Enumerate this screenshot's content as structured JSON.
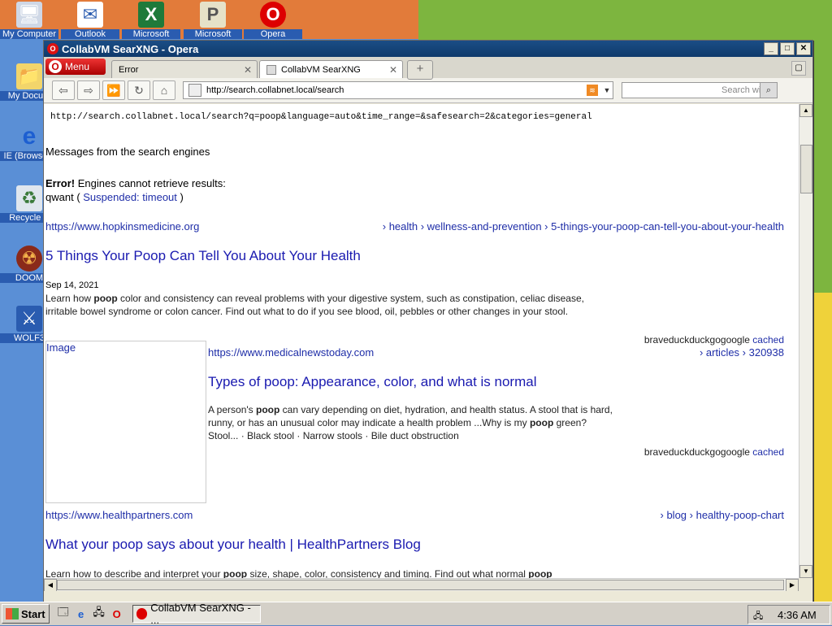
{
  "desktop": {
    "icons": [
      {
        "label": "My Computer",
        "icon": "computer-icon",
        "glyph": "🖥"
      },
      {
        "label": "Outlook",
        "icon": "outlook-icon",
        "glyph": "✉"
      },
      {
        "label": "Microsoft",
        "icon": "excel-icon",
        "glyph": "X"
      },
      {
        "label": "Microsoft",
        "icon": "project-icon",
        "glyph": "P"
      },
      {
        "label": "Opera",
        "icon": "opera-icon",
        "glyph": "O"
      },
      {
        "label": "My Docum",
        "icon": "folder-icon",
        "glyph": "📁"
      },
      {
        "label": "IE (Browserv",
        "icon": "ie-icon",
        "glyph": "e"
      },
      {
        "label": "Recycle B",
        "icon": "recycle-bin-icon",
        "glyph": "♻"
      },
      {
        "label": "DOOM",
        "icon": "doom-icon",
        "glyph": "☢"
      },
      {
        "label": "WOLF3",
        "icon": "wolf3d-icon",
        "glyph": "⚔"
      }
    ]
  },
  "window": {
    "title": "CollabVM SearXNG - Opera",
    "menu_label": "Menu",
    "tabs": [
      {
        "label": "Error"
      },
      {
        "label": "CollabVM SearXNG"
      }
    ],
    "address": "http://search.collabnet.local/search",
    "search_placeholder": "Search with Co"
  },
  "page": {
    "raw_url": "http://search.collabnet.local/search?q=poop&language=auto&time_range=&safesearch=2&categories=general",
    "messages_heading": "Messages from the search engines",
    "error_label": "Error!",
    "error_text": " Engines cannot retrieve results:",
    "engine_name": "qwant",
    "engine_status": "Suspended: timeout",
    "results": [
      {
        "url": "https://www.hopkinsmedicine.org",
        "crumbs": "› health › wellness-and-prevention › 5-things-your-poop-can-tell-you-about-your-health",
        "title": "5 Things Your Poop Can Tell You About Your Health",
        "date": "Sep 14, 2021",
        "snippet_parts": [
          "Learn how ",
          "poop",
          " color and consistency can reveal problems with your digestive system, such as constipation, celiac disease, irritable bowel syndrome or colon cancer. Find out what to do if you see blood, oil, pebbles or other changes in your stool."
        ],
        "engines": "braveduckduckgogoogle",
        "cached": "cached"
      },
      {
        "image_label": "Image",
        "url": "https://www.medicalnewstoday.com",
        "crumbs": "› articles › 320938",
        "title": "Types of poop: Appearance, color, and what is normal",
        "snippet_parts": [
          "A person's ",
          "poop",
          " can vary depending on diet, hydration, and health status. A stool that is hard, runny, or has an unusual color may indicate a health problem ...Why is my ",
          "poop",
          " green? Stool... · Black stool · Narrow stools · Bile duct obstruction"
        ],
        "engines": "braveduckduckgogoogle",
        "cached": "cached"
      },
      {
        "url": "https://www.healthpartners.com",
        "crumbs": "› blog › healthy-poop-chart",
        "title": "What your poop says about your health | HealthPartners Blog",
        "snippet_parts": [
          "Learn how to describe and interpret your ",
          "poop",
          " size, shape, color, consistency and timing. Find out what normal ",
          "poop"
        ]
      }
    ]
  },
  "taskbar": {
    "start_label": "Start",
    "task_label": "CollabVM SearXNG - ...",
    "clock": "4:36 AM"
  }
}
